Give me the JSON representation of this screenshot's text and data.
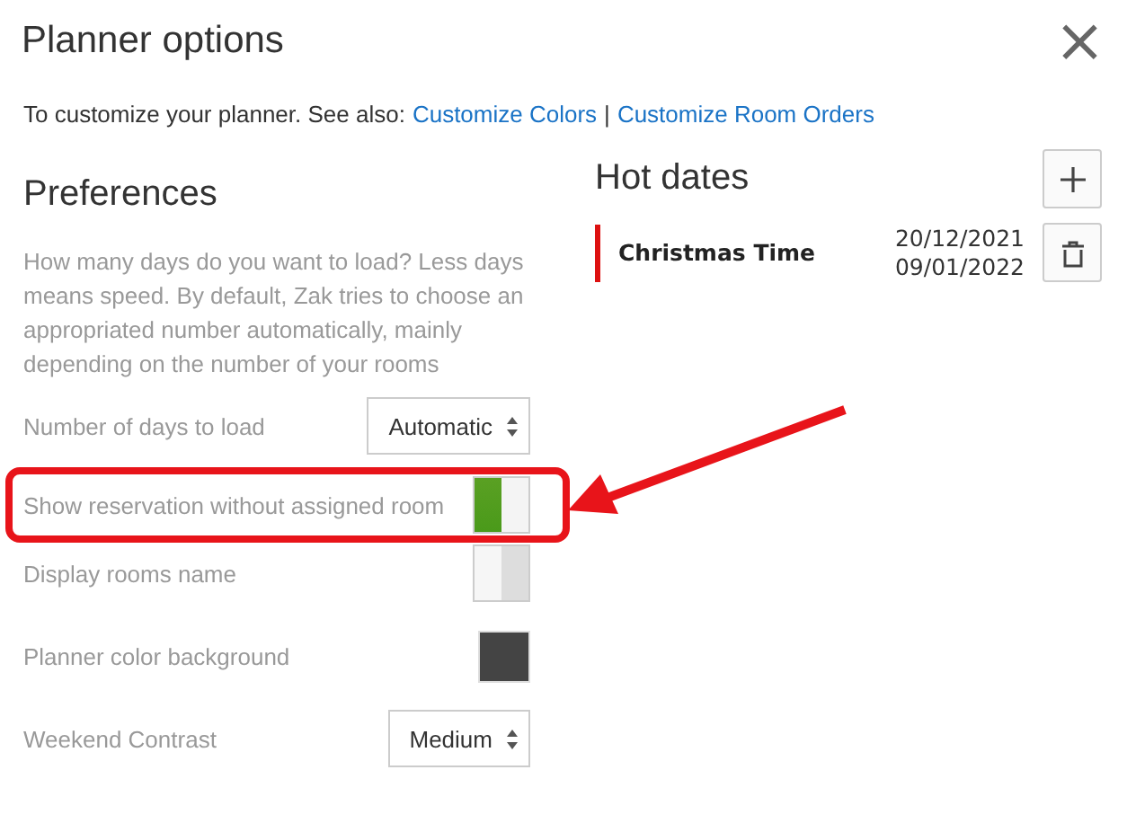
{
  "dialog": {
    "title": "Planner options",
    "close_icon": "×"
  },
  "intro": {
    "text": "To customize your planner. See also:",
    "links": [
      {
        "label": "Customize Colors"
      },
      {
        "label": "Customize Room Orders"
      }
    ],
    "separator": "|"
  },
  "preferences": {
    "heading": "Preferences",
    "description": "How many days do you want to load? Less days means speed. By default, Zak tries to choose an appropriated number automatically, mainly depending on the number of your rooms",
    "settings": [
      {
        "kind": "select",
        "label": "Number of days to load",
        "value": "Automatic",
        "highlighted": false
      },
      {
        "kind": "toggle",
        "label": "Show reservation without assigned room",
        "on": true,
        "highlighted": true
      },
      {
        "kind": "toggle",
        "label": "Display rooms name",
        "on": false,
        "highlighted": false
      },
      {
        "kind": "color",
        "label": "Planner color background",
        "color": "#444444",
        "highlighted": false
      },
      {
        "kind": "select",
        "label": "Weekend Contrast",
        "value": "Medium",
        "highlighted": false
      }
    ]
  },
  "hot_dates": {
    "heading": "Hot dates",
    "items": [
      {
        "name": "Christmas Time",
        "start": "20/12/2021",
        "end": "09/01/2022",
        "color": "#dd1111"
      }
    ]
  }
}
